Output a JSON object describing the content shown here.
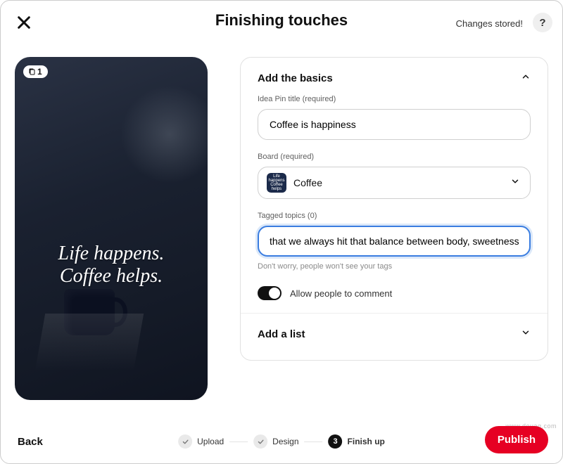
{
  "header": {
    "title": "Finishing touches",
    "status": "Changes stored!",
    "help_glyph": "?"
  },
  "preview": {
    "page_badge": "1",
    "overlay_text": "Life happens.\nCoffee helps."
  },
  "basics": {
    "section_title": "Add the basics",
    "title_label": "Idea Pin title (required)",
    "title_value": "Coffee is happiness",
    "board_label": "Board (required)",
    "board_name": "Coffee",
    "board_thumb_text": "Life happens Coffee helps",
    "topics_label": "Tagged topics (0)",
    "topics_value": "that we always hit that balance between body, sweetness, and acidity.",
    "topics_hint": "Don't worry, people won't see your tags",
    "comment_toggle_label": "Allow people to comment",
    "comment_toggle_on": true
  },
  "list_section": {
    "title": "Add a list"
  },
  "footer": {
    "back_label": "Back",
    "publish_label": "Publish",
    "steps": [
      {
        "label": "Upload",
        "state": "done"
      },
      {
        "label": "Design",
        "state": "done"
      },
      {
        "label": "Finish up",
        "state": "active",
        "number": "3"
      }
    ]
  },
  "watermark": "www.deuaq.com"
}
